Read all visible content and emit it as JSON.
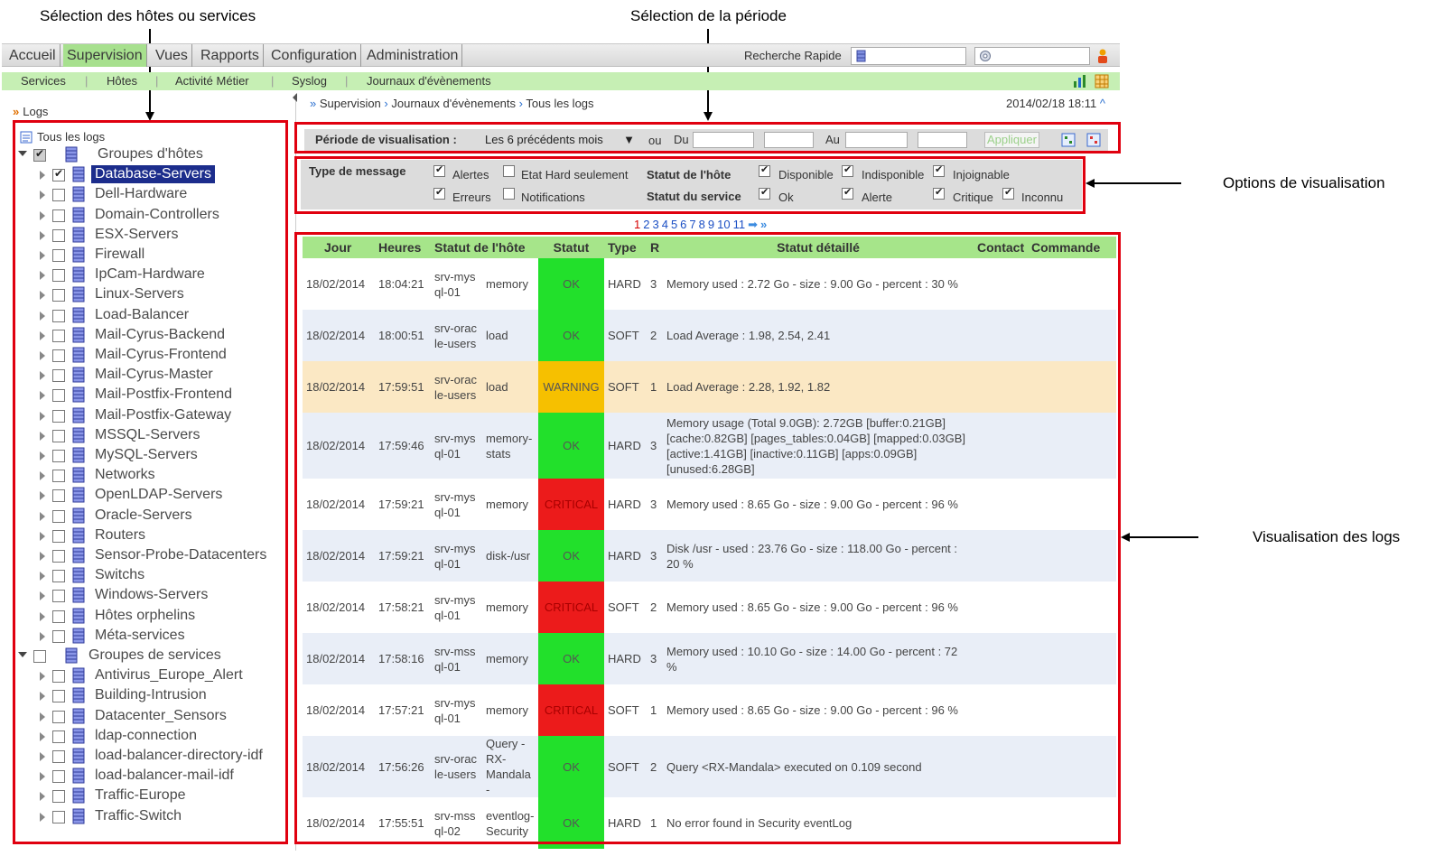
{
  "annotations": {
    "host_selection": "Sélection des hôtes ou services",
    "period_selection": "Sélection de la période",
    "view_options": "Options de visualisation",
    "log_view": "Visualisation des logs"
  },
  "topmenu": {
    "items": [
      "Accueil",
      "Supervision",
      "Vues",
      "Rapports",
      "Configuration",
      "Administration"
    ],
    "active": "Supervision",
    "quick_search_label": "Recherche Rapide"
  },
  "submenu": {
    "items": [
      "Services",
      "Hôtes",
      "Activité Métier",
      "Syslog",
      "Journaux d'évènements"
    ]
  },
  "sidebar": {
    "title": "Logs",
    "root": "Tous les logs",
    "host_groups_label": "Groupes d'hôtes",
    "host_groups": [
      {
        "label": "Database-Servers",
        "checked": true,
        "selected": true
      },
      {
        "label": "Dell-Hardware",
        "checked": false
      },
      {
        "label": "Domain-Controllers",
        "checked": false
      },
      {
        "label": "ESX-Servers",
        "checked": false
      },
      {
        "label": "Firewall",
        "checked": false
      },
      {
        "label": "IpCam-Hardware",
        "checked": false
      },
      {
        "label": "Linux-Servers",
        "checked": false
      },
      {
        "label": "Load-Balancer",
        "checked": false
      },
      {
        "label": "Mail-Cyrus-Backend",
        "checked": false
      },
      {
        "label": "Mail-Cyrus-Frontend",
        "checked": false
      },
      {
        "label": "Mail-Cyrus-Master",
        "checked": false
      },
      {
        "label": "Mail-Postfix-Frontend",
        "checked": false
      },
      {
        "label": "Mail-Postfix-Gateway",
        "checked": false
      },
      {
        "label": "MSSQL-Servers",
        "checked": false
      },
      {
        "label": "MySQL-Servers",
        "checked": false
      },
      {
        "label": "Networks",
        "checked": false
      },
      {
        "label": "OpenLDAP-Servers",
        "checked": false
      },
      {
        "label": "Oracle-Servers",
        "checked": false
      },
      {
        "label": "Routers",
        "checked": false
      },
      {
        "label": "Sensor-Probe-Datacenters",
        "checked": false
      },
      {
        "label": "Switchs",
        "checked": false
      },
      {
        "label": "Windows-Servers",
        "checked": false
      },
      {
        "label": "Hôtes orphelins",
        "checked": false
      },
      {
        "label": "Méta-services",
        "checked": false
      }
    ],
    "service_groups_label": "Groupes de services",
    "service_groups": [
      {
        "label": "Antivirus_Europe_Alert"
      },
      {
        "label": "Building-Intrusion"
      },
      {
        "label": "Datacenter_Sensors"
      },
      {
        "label": "ldap-connection"
      },
      {
        "label": "load-balancer-directory-idf"
      },
      {
        "label": "load-balancer-mail-idf"
      },
      {
        "label": "Traffic-Europe"
      },
      {
        "label": "Traffic-Switch"
      }
    ]
  },
  "breadcrumb": {
    "items": [
      "Supervision",
      "Journaux d'évènements",
      "Tous les logs"
    ],
    "datetime": "2014/02/18 18:11"
  },
  "period": {
    "label": "Période de visualisation :",
    "selected": "Les 6 précédents mois",
    "or_label": "ou",
    "from_label": "Du",
    "to_label": "Au",
    "apply_label": "Appliquer"
  },
  "options": {
    "message_type_label": "Type de message",
    "alerts": {
      "label": "Alertes",
      "checked": true
    },
    "hard_only": {
      "label": "Etat Hard seulement",
      "checked": false
    },
    "errors": {
      "label": "Erreurs",
      "checked": true
    },
    "notifications": {
      "label": "Notifications",
      "checked": false
    },
    "host_status_label": "Statut de l'hôte",
    "service_status_label": "Statut du service",
    "available": {
      "label": "Disponible",
      "checked": true
    },
    "unavailable": {
      "label": "Indisponible",
      "checked": true
    },
    "unreachable": {
      "label": "Injoignable",
      "checked": true
    },
    "ok": {
      "label": "Ok",
      "checked": true
    },
    "alert": {
      "label": "Alerte",
      "checked": true
    },
    "critical": {
      "label": "Critique",
      "checked": true
    },
    "unknown": {
      "label": "Inconnu",
      "checked": true
    }
  },
  "pager": {
    "pages": [
      "1",
      "2",
      "3",
      "4",
      "5",
      "6",
      "7",
      "8",
      "9",
      "10",
      "11"
    ],
    "current": "1"
  },
  "table": {
    "columns": [
      "Jour",
      "Heures",
      "Statut de l'hôte",
      "Statut",
      "Type",
      "R",
      "Statut détaillé",
      "Contact",
      "Commande"
    ],
    "rows": [
      {
        "day": "18/02/2014",
        "time": "18:04:21",
        "host": "srv-mysql-01",
        "service": "memory",
        "status": "OK",
        "type": "HARD",
        "r": "3",
        "detail": "Memory used : 2.72 Go - size : 9.00 Go - percent : 30 %"
      },
      {
        "day": "18/02/2014",
        "time": "18:00:51",
        "host": "srv-oracle-users",
        "service": "load",
        "status": "OK",
        "type": "SOFT",
        "r": "2",
        "detail": "Load Average : 1.98, 2.54, 2.41"
      },
      {
        "day": "18/02/2014",
        "time": "17:59:51",
        "host": "srv-oracle-users",
        "service": "load",
        "status": "WARNING",
        "type": "SOFT",
        "r": "1",
        "detail": "Load Average : 2.28, 1.92, 1.82"
      },
      {
        "day": "18/02/2014",
        "time": "17:59:46",
        "host": "srv-mysql-01",
        "service": "memory-stats",
        "status": "OK",
        "type": "HARD",
        "r": "3",
        "detail": "Memory usage (Total 9.0GB): 2.72GB [buffer:0.21GB] [cache:0.82GB] [pages_tables:0.04GB] [mapped:0.03GB] [active:1.41GB] [inactive:0.11GB] [apps:0.09GB] [unused:6.28GB]"
      },
      {
        "day": "18/02/2014",
        "time": "17:59:21",
        "host": "srv-mysql-01",
        "service": "memory",
        "status": "CRITICAL",
        "type": "HARD",
        "r": "3",
        "detail": "Memory used : 8.65 Go - size : 9.00 Go - percent : 96 %"
      },
      {
        "day": "18/02/2014",
        "time": "17:59:21",
        "host": "srv-mysql-01",
        "service": "disk-/usr",
        "status": "OK",
        "type": "HARD",
        "r": "3",
        "detail": "Disk /usr - used : 23.76 Go - size : 118.00 Go - percent : 20 %"
      },
      {
        "day": "18/02/2014",
        "time": "17:58:21",
        "host": "srv-mysql-01",
        "service": "memory",
        "status": "CRITICAL",
        "type": "SOFT",
        "r": "2",
        "detail": "Memory used : 8.65 Go - size : 9.00 Go - percent : 96 %"
      },
      {
        "day": "18/02/2014",
        "time": "17:58:16",
        "host": "srv-mssql-01",
        "service": "memory",
        "status": "OK",
        "type": "HARD",
        "r": "3",
        "detail": "Memory used : 10.10 Go - size : 14.00 Go - percent : 72 %"
      },
      {
        "day": "18/02/2014",
        "time": "17:57:21",
        "host": "srv-mysql-01",
        "service": "memory",
        "status": "CRITICAL",
        "type": "SOFT",
        "r": "1",
        "detail": "Memory used : 8.65 Go - size : 9.00 Go - percent : 96 %"
      },
      {
        "day": "18/02/2014",
        "time": "17:56:26",
        "host": "srv-oracle-users",
        "service": "Query - RX-Mandala-",
        "status": "OK",
        "type": "SOFT",
        "r": "2",
        "detail": "Query <RX-Mandala> executed on 0.109 second"
      },
      {
        "day": "18/02/2014",
        "time": "17:55:51",
        "host": "srv-mssql-02",
        "service": "eventlog-Security",
        "status": "OK",
        "type": "HARD",
        "r": "1",
        "detail": "No error found in Security eventLog"
      }
    ]
  },
  "colors": {
    "ok": "#22e02b",
    "warning": "#f6c000",
    "critical": "#ec1b1b",
    "menu_active": "#a7e08e",
    "header_green": "#a6e58a",
    "annotation_red": "#e0000f"
  }
}
